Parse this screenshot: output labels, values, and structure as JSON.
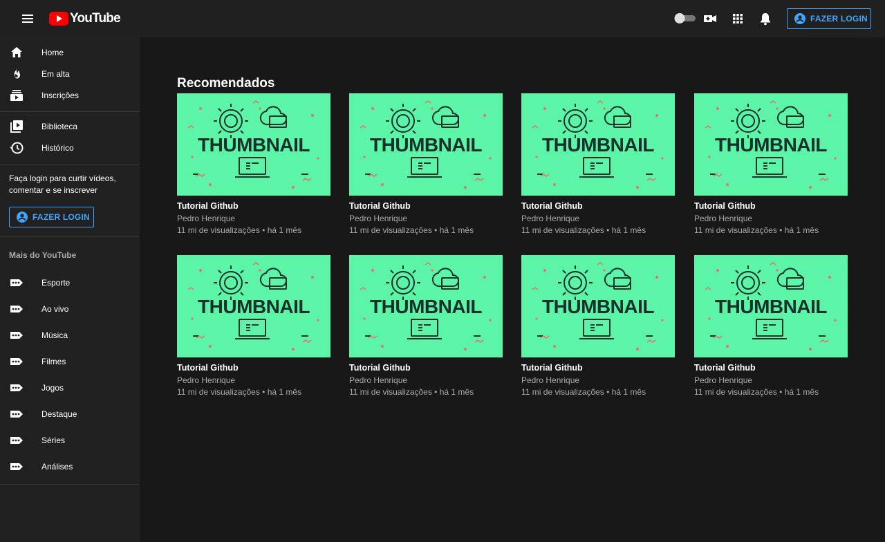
{
  "header": {
    "logo_text": "YouTube",
    "login_label": "FAZER LOGIN",
    "icons": [
      "menu-icon",
      "dark-mode-toggle",
      "create-video-icon",
      "apps-grid-icon",
      "notifications-bell-icon",
      "account-circle-icon"
    ]
  },
  "sidebar": {
    "primary": [
      {
        "label": "Home",
        "icon": "home-icon"
      },
      {
        "label": "Em alta",
        "icon": "trending-fire-icon"
      },
      {
        "label": "Inscrições",
        "icon": "subscriptions-icon"
      }
    ],
    "library": [
      {
        "label": "Biblioteca",
        "icon": "library-icon"
      },
      {
        "label": "Histórico",
        "icon": "history-icon"
      }
    ],
    "login_hint": "Faça login para curtir vídeos, comentar e se inscrever",
    "login_label": "FAZER LOGIN",
    "more_title": "Mais do YouTube",
    "more": [
      {
        "label": "Esporte",
        "icon": "more-icon"
      },
      {
        "label": "Ao vivo",
        "icon": "more-icon"
      },
      {
        "label": "Música",
        "icon": "more-icon"
      },
      {
        "label": "Filmes",
        "icon": "more-icon"
      },
      {
        "label": "Jogos",
        "icon": "more-icon"
      },
      {
        "label": "Destaque",
        "icon": "more-icon"
      },
      {
        "label": "Séries",
        "icon": "more-icon"
      },
      {
        "label": "Análises",
        "icon": "more-icon"
      }
    ]
  },
  "main": {
    "title": "Recomendados",
    "videos": [
      {
        "thumb_text": "THUMBNAIL",
        "title": "Tutorial Github",
        "channel": "Pedro Henrique",
        "meta": "11 mi de visualizações • há 1 mês"
      },
      {
        "thumb_text": "THUMBNAIL",
        "title": "Tutorial Github",
        "channel": "Pedro Henrique",
        "meta": "11 mi de visualizações • há 1 mês"
      },
      {
        "thumb_text": "THUMBNAIL",
        "title": "Tutorial Github",
        "channel": "Pedro Henrique",
        "meta": "11 mi de visualizações • há 1 mês"
      },
      {
        "thumb_text": "THUMBNAIL",
        "title": "Tutorial Github",
        "channel": "Pedro Henrique",
        "meta": "11 mi de visualizações • há 1 mês"
      },
      {
        "thumb_text": "THUMBNAIL",
        "title": "Tutorial Github",
        "channel": "Pedro Henrique",
        "meta": "11 mi de visualizações • há 1 mês"
      },
      {
        "thumb_text": "THUMBNAIL",
        "title": "Tutorial Github",
        "channel": "Pedro Henrique",
        "meta": "11 mi de visualizações • há 1 mês"
      },
      {
        "thumb_text": "THUMBNAIL",
        "title": "Tutorial Github",
        "channel": "Pedro Henrique",
        "meta": "11 mi de visualizações • há 1 mês"
      },
      {
        "thumb_text": "THUMBNAIL",
        "title": "Tutorial Github",
        "channel": "Pedro Henrique",
        "meta": "11 mi de visualizações • há 1 mês"
      }
    ]
  },
  "colors": {
    "background": "#181818",
    "sidebar": "#212121",
    "header": "#202020",
    "accent_blue": "#3ea6ff",
    "logo_red": "#ff0000",
    "thumbnail_bg": "#5cf5a8",
    "thumbnail_ink": "#17302a",
    "thumbnail_accent": "#e8706a"
  }
}
